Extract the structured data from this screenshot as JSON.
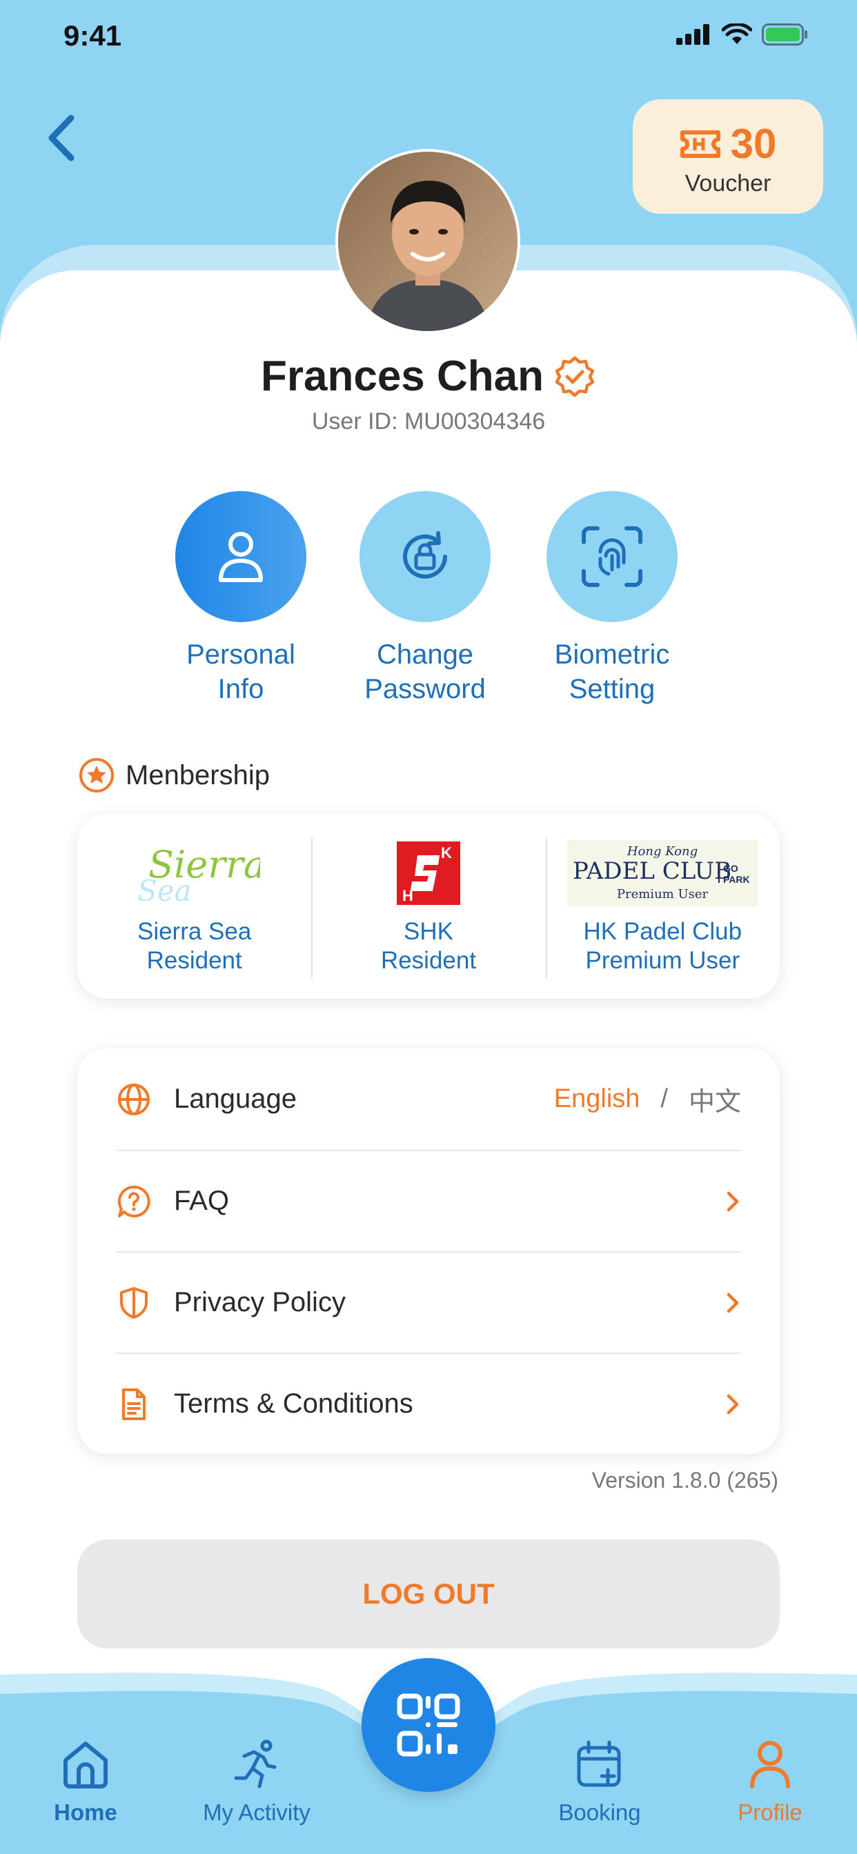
{
  "status_bar": {
    "time": "9:41"
  },
  "voucher": {
    "count": "30",
    "label": "Voucher"
  },
  "profile": {
    "name": "Frances Chan",
    "user_id": "User ID: MU00304346"
  },
  "actions": [
    {
      "label": "Personal\nInfo",
      "icon": "user-icon"
    },
    {
      "label": "Change\nPassword",
      "icon": "lock-reset-icon"
    },
    {
      "label": "Biometric\nSetting",
      "icon": "face-id-icon"
    }
  ],
  "membership": {
    "title": "Menbership",
    "items": [
      {
        "label": "Sierra Sea\nResident",
        "logo_text": "Sierra Sea"
      },
      {
        "label": "SHK\nResident",
        "logo_text": "SHK"
      },
      {
        "label": "HK Padel Club\nPremium User",
        "logo_text": "Hong Kong PADEL CLUB GO PARK Premium User"
      }
    ]
  },
  "settings": {
    "language": {
      "label": "Language",
      "en": "English",
      "sep": "/",
      "zh": "中文"
    },
    "faq": {
      "label": "FAQ"
    },
    "privacy": {
      "label": "Privacy Policy"
    },
    "terms": {
      "label": "Terms & Conditions"
    }
  },
  "version": "Version  1.8.0 (265)",
  "logout": "LOG OUT",
  "tabs": [
    {
      "label": "Home",
      "icon": "home-icon"
    },
    {
      "label": "My Activity",
      "icon": "running-icon"
    },
    {
      "label": "QR",
      "icon": "qr-code-icon"
    },
    {
      "label": "Booking",
      "icon": "calendar-add-icon"
    },
    {
      "label": "Profile",
      "icon": "profile-icon"
    }
  ],
  "colors": {
    "accent_blue": "#1f86e6",
    "accent_orange": "#f07a2a",
    "sky": "#8fd5f3"
  }
}
